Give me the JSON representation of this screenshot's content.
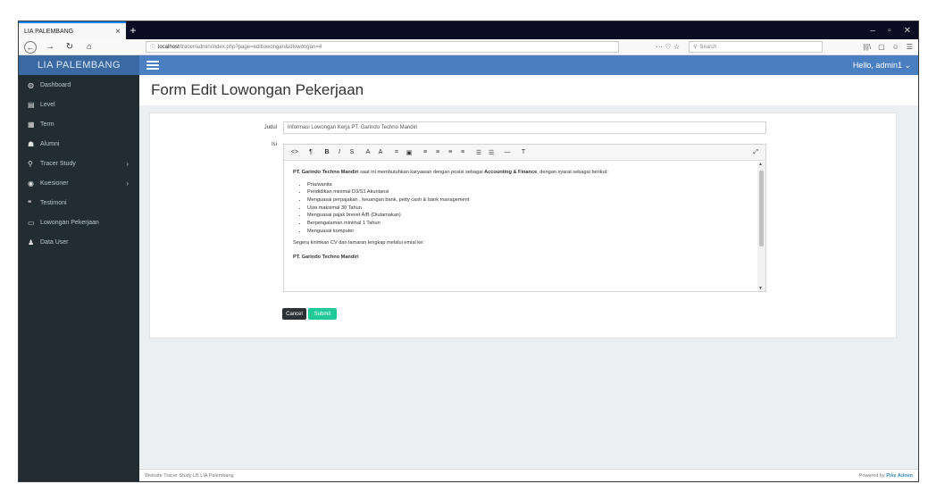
{
  "browser": {
    "tab_title": "LIA PALEMBANG",
    "tab_close": "×",
    "new_tab": "+",
    "url_host": "localhost",
    "url_path": "/tracer/admin/index.php?page=editlowongan&idlowongan=4",
    "url_icons": "··· ♡ ☆",
    "search_placeholder": "Search",
    "toolbar_icons": [
      "|||\\",
      "▢",
      "☺",
      "☰"
    ],
    "win_controls": [
      "–",
      "▫",
      "✕"
    ]
  },
  "app": {
    "brand": "LIA PALEMBANG",
    "hello": "Hello, admin1 ⌄"
  },
  "sidebar": {
    "items": [
      {
        "label": "Dashboard",
        "icon": "tachometer-icon",
        "glyph": "◍"
      },
      {
        "label": "Level",
        "icon": "list-icon",
        "glyph": "▤"
      },
      {
        "label": "Term",
        "icon": "calendar-icon",
        "glyph": "▦"
      },
      {
        "label": "Alumni",
        "icon": "users-icon",
        "glyph": "☗"
      },
      {
        "label": "Tracer Study",
        "icon": "search-icon",
        "glyph": "⚲",
        "arrow": "›"
      },
      {
        "label": "Kuesioner",
        "icon": "question-icon",
        "glyph": "◉",
        "arrow": "›"
      },
      {
        "label": "Testimoni",
        "icon": "quote-icon",
        "glyph": "❝"
      },
      {
        "label": "Lowongan Pekerjaan",
        "icon": "keyboard-icon",
        "glyph": "▭"
      },
      {
        "label": "Data User",
        "icon": "user-icon",
        "glyph": "♟"
      }
    ]
  },
  "page": {
    "title": "Form Edit Lowongan Pekerjaan",
    "judul_label": "Judul",
    "judul_value": "Informasi Lowongan Kerja PT. Garindo Techno Mandiri",
    "isi_label": "Isi",
    "cancel_label": "Cancel",
    "submit_label": "Submit"
  },
  "editor": {
    "toolbar": [
      "<>",
      "¶",
      "B",
      "I",
      "S",
      "A",
      "A",
      "⌗",
      "▣",
      "≡",
      "≡",
      "≡",
      "≡",
      "☰",
      "☰",
      "—",
      "T"
    ],
    "expand": "⤢",
    "intro_bold_1": "PT. Garindo Techno Mandiri",
    "intro_text_1": " saat ini membutuhkan karyawan dengan posisi sebagai ",
    "intro_bold_2": "Accounting & Finance",
    "intro_text_2": ", dengan syarat sebagai berikut:",
    "requirements": [
      "Pria/wanita",
      "Pendidikan minimal D3/S1 Akuntansi",
      "Menguasai perpajakan , keuangan bank, petty cash & bank management",
      "Usia maksimal 30 Tahun",
      "Menguasai pajak brevet A/B (Diutamakan)",
      "Berpengalaman minimal 1 Tahun",
      "Menguasai komputer"
    ],
    "closing": "Segera kirimkan CV dan lamaran lengkap melalui emial ke:",
    "signature": "PT. Garindo Techno Mandiri"
  },
  "footer": {
    "left": "Website Tracer Study LB LIA Palembang",
    "right_prefix": "Powered by ",
    "right_brand": "Pike Admin"
  }
}
